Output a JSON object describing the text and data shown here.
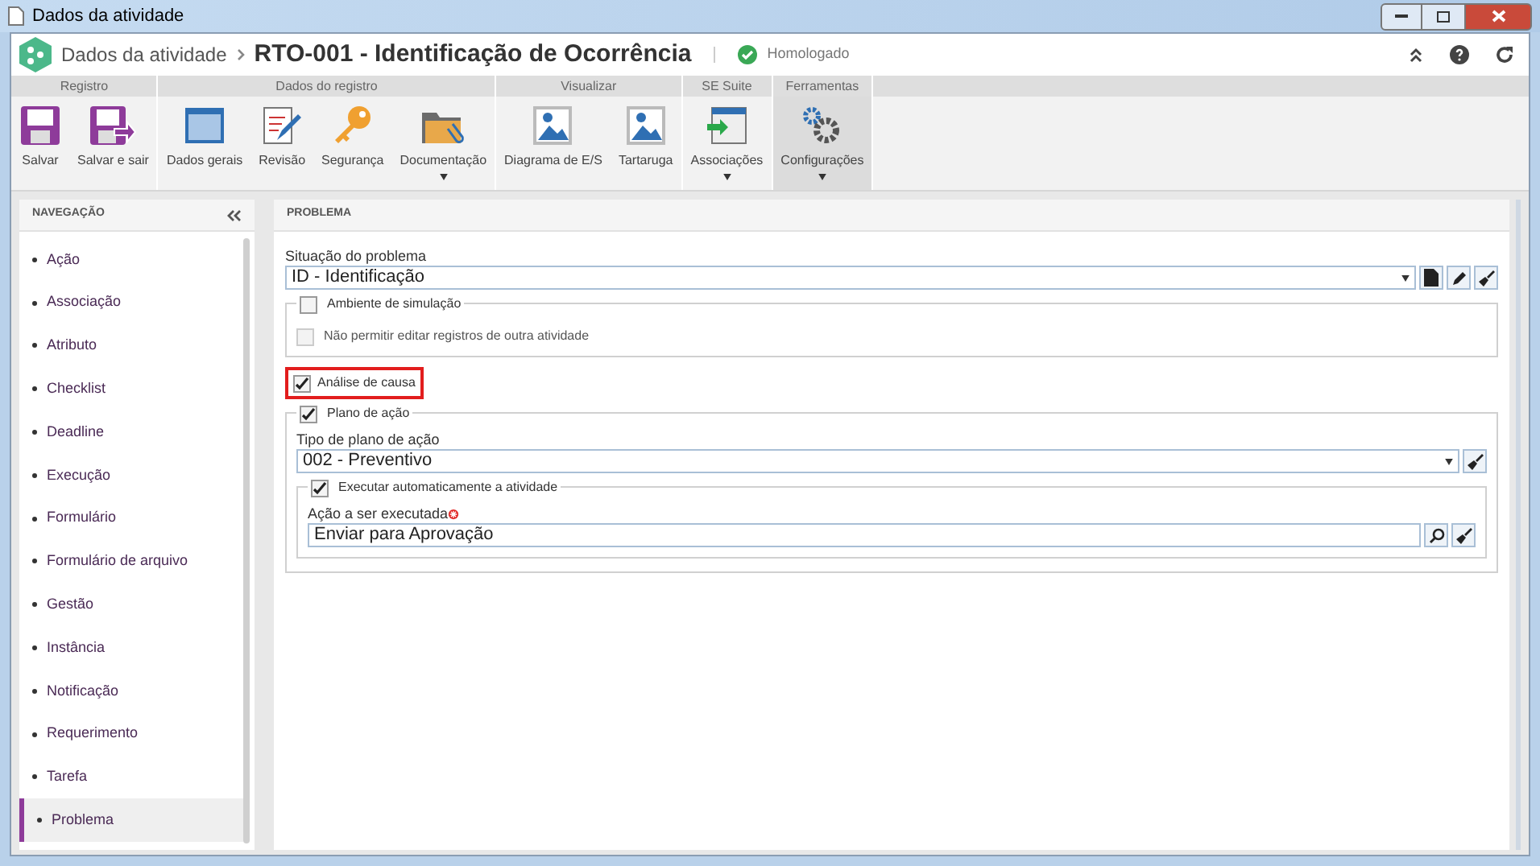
{
  "window": {
    "title": "Dados da atividade"
  },
  "header": {
    "breadcrumb": "Dados da atividade",
    "title": "RTO-001 - Identificação de Ocorrência",
    "status": "Homologado"
  },
  "ribbon": [
    {
      "group": "Registro",
      "buttons": [
        {
          "label": "Salvar",
          "kind": "save",
          "dropdown": false,
          "selected": false
        },
        {
          "label": "Salvar e sair",
          "kind": "save-exit",
          "dropdown": false,
          "selected": false
        }
      ]
    },
    {
      "group": "Dados do registro",
      "buttons": [
        {
          "label": "Dados gerais",
          "kind": "window",
          "dropdown": false,
          "selected": false
        },
        {
          "label": "Revisão",
          "kind": "review",
          "dropdown": false,
          "selected": false
        },
        {
          "label": "Segurança",
          "kind": "key",
          "dropdown": false,
          "selected": false
        },
        {
          "label": "Documentação",
          "kind": "folder",
          "dropdown": true,
          "selected": false
        }
      ]
    },
    {
      "group": "Visualizar",
      "buttons": [
        {
          "label": "Diagrama de E/S",
          "kind": "image",
          "dropdown": false,
          "selected": false
        },
        {
          "label": "Tartaruga",
          "kind": "image",
          "dropdown": false,
          "selected": false
        }
      ]
    },
    {
      "group": "SE Suite",
      "buttons": [
        {
          "label": "Associações",
          "kind": "assoc",
          "dropdown": true,
          "selected": false
        }
      ]
    },
    {
      "group": "Ferramentas",
      "buttons": [
        {
          "label": "Configurações",
          "kind": "gears",
          "dropdown": true,
          "selected": true
        }
      ]
    }
  ],
  "navigation": {
    "title": "NAVEGAÇÃO",
    "items": [
      {
        "label": "Ação",
        "selected": false
      },
      {
        "label": "Associação",
        "selected": false
      },
      {
        "label": "Atributo",
        "selected": false
      },
      {
        "label": "Checklist",
        "selected": false
      },
      {
        "label": "Deadline",
        "selected": false
      },
      {
        "label": "Execução",
        "selected": false
      },
      {
        "label": "Formulário",
        "selected": false
      },
      {
        "label": "Formulário de arquivo",
        "selected": false
      },
      {
        "label": "Gestão",
        "selected": false
      },
      {
        "label": "Instância",
        "selected": false
      },
      {
        "label": "Notificação",
        "selected": false
      },
      {
        "label": "Requerimento",
        "selected": false
      },
      {
        "label": "Tarefa",
        "selected": false
      },
      {
        "label": "Problema",
        "selected": true
      }
    ]
  },
  "panel": {
    "title": "PROBLEMA",
    "situation": {
      "label": "Situação do problema",
      "value": "ID - Identificação"
    },
    "simulation": {
      "label": "Ambiente de simulação",
      "checked": false,
      "option": {
        "label": "Não permitir editar registros de outra atividade",
        "checked": false,
        "disabled": true
      }
    },
    "cause_analysis": {
      "label": "Análise de causa",
      "checked": true,
      "highlighted": true
    },
    "action_plan": {
      "label": "Plano de ação",
      "checked": true,
      "type": {
        "label": "Tipo de plano de ação",
        "value": "002 - Preventivo"
      },
      "auto_execute": {
        "label": "Executar automaticamente a atividade",
        "checked": true,
        "action": {
          "label": "Ação a ser executada",
          "required": true,
          "value": "Enviar para Aprovação"
        }
      }
    }
  }
}
